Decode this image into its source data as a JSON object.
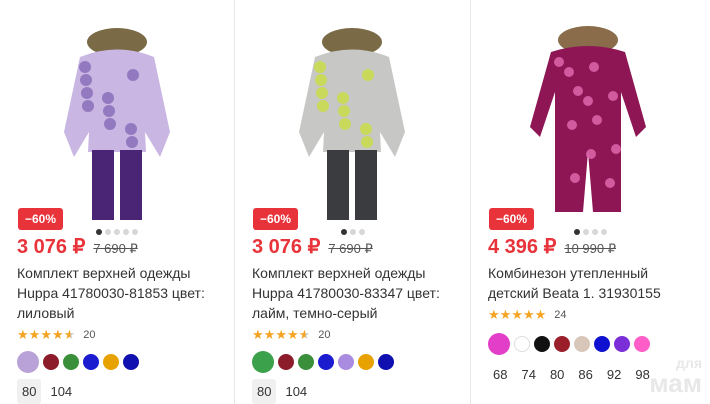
{
  "products": [
    {
      "discount": "−60%",
      "price": "3 076 ₽",
      "old_price": "7 690 ₽",
      "title": "Комплект верхней одежды Huppa 41780030-81853 цвет: лиловый",
      "rating": 4.5,
      "reviews": "20",
      "swatches": [
        "#b9a2d8",
        "#8d1c2b",
        "#3a8f3a",
        "#1b1bd0",
        "#e8a200",
        "#1010b0"
      ],
      "sizes": [
        "80",
        "104"
      ],
      "selected_size": "80",
      "image_colors": {
        "jacket": "#c9b6e2",
        "print": "#7c5fb2",
        "pants": "#4a2575",
        "fur": "#7a6a45"
      }
    },
    {
      "discount": "−60%",
      "price": "3 076 ₽",
      "old_price": "7 690 ₽",
      "title": "Комплект верхней одежды Huppa 41780030-83347 цвет: лайм, темно-серый",
      "rating": 4.5,
      "reviews": "20",
      "swatches": [
        "#3ca14b",
        "#8d1c2b",
        "#3a8f3a",
        "#1b1bd0",
        "#a98be0",
        "#e8a200",
        "#1010b0"
      ],
      "sizes": [
        "80",
        "104"
      ],
      "selected_size": "80",
      "image_colors": {
        "jacket": "#c7c8c5",
        "print": "#c9df2f",
        "pants": "#3b3c3f",
        "fur": "#7a6a45"
      }
    },
    {
      "discount": "−60%",
      "price": "4 396 ₽",
      "old_price": "10 990 ₽",
      "title": "Комбинезон утепленный детский Beata 1. 31930155",
      "rating": 5,
      "reviews": "24",
      "swatches": [
        "#e33ec8",
        "#ffffff",
        "#111111",
        "#9b1f2a",
        "#d8c7b9",
        "#1010d0",
        "#7a2fd8",
        "#ff5ec8"
      ],
      "sizes": [
        "68",
        "74",
        "80",
        "86",
        "92",
        "98"
      ],
      "selected_size": "",
      "image_colors": {
        "jacket": "#8e1655",
        "print": "#e46bb0",
        "pants": "#8e1655",
        "fur": "#8a6c4a"
      }
    }
  ],
  "watermark": {
    "line1": "для",
    "line2": "мам"
  },
  "colors": {
    "accent": "#e8333a",
    "star": "#f4a422"
  }
}
